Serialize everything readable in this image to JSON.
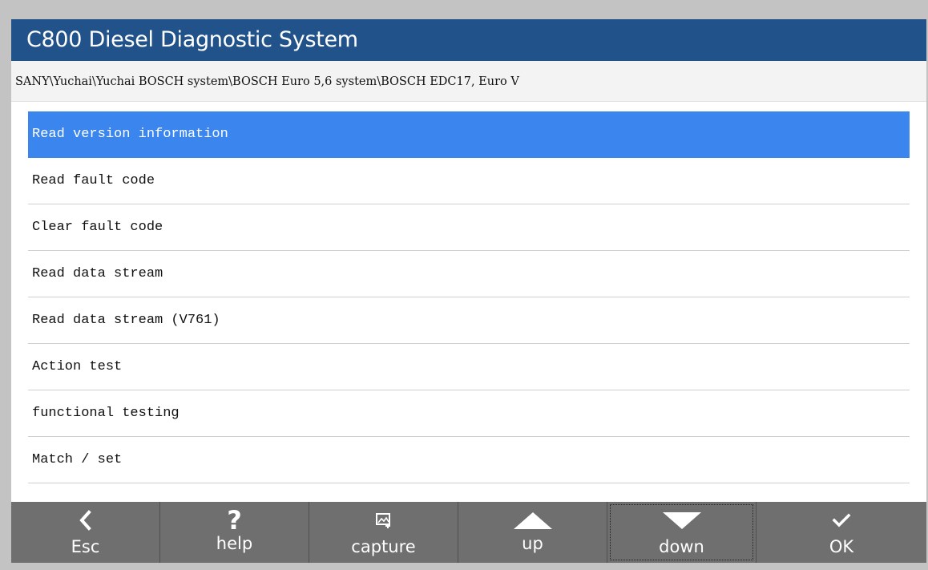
{
  "app": {
    "title": "C800 Diesel Diagnostic System"
  },
  "breadcrumb": {
    "path": "SANY\\Yuchai\\Yuchai BOSCH system\\BOSCH Euro 5,6 system\\BOSCH EDC17, Euro V"
  },
  "menu": {
    "selected_index": 0,
    "items": [
      {
        "label": "Read version information"
      },
      {
        "label": "Read fault code"
      },
      {
        "label": "Clear fault code"
      },
      {
        "label": "Read data stream"
      },
      {
        "label": "Read data stream (V761)"
      },
      {
        "label": "Action test"
      },
      {
        "label": "functional testing"
      },
      {
        "label": "Match / set"
      }
    ]
  },
  "toolbar": {
    "esc": {
      "label": "Esc",
      "icon": "chevron-left-icon"
    },
    "help": {
      "label": "help",
      "icon": "question-icon"
    },
    "capture": {
      "label": "capture",
      "icon": "capture-icon"
    },
    "up": {
      "label": "up",
      "icon": "triangle-up-icon"
    },
    "down": {
      "label": "down",
      "icon": "triangle-down-icon"
    },
    "ok": {
      "label": "OK",
      "icon": "checkmark-icon"
    }
  },
  "colors": {
    "title_bar": "#21528a",
    "selected_item": "#3a86ee",
    "toolbar": "#6f6f6f"
  }
}
